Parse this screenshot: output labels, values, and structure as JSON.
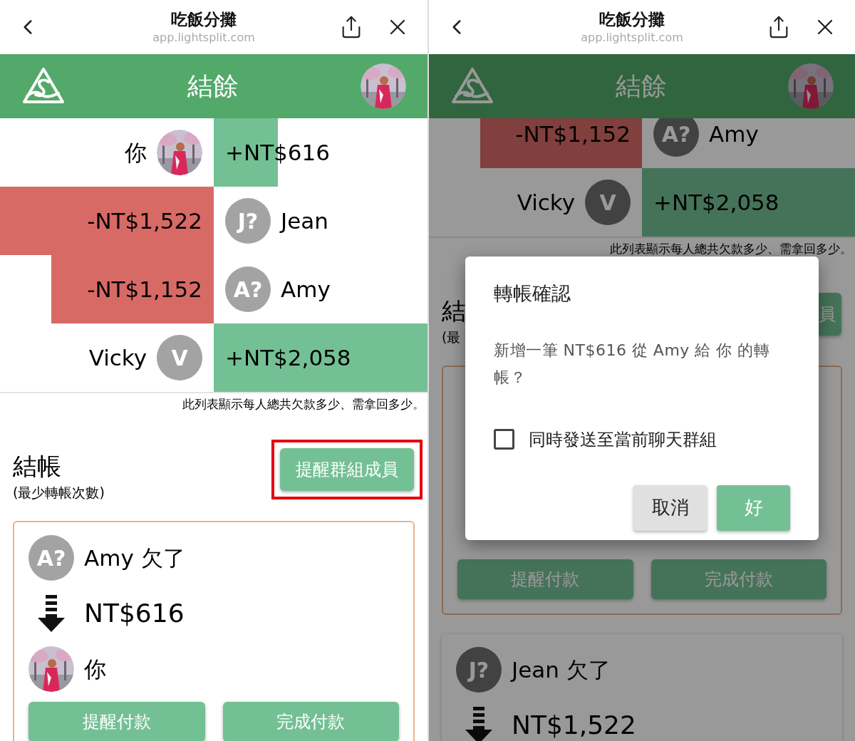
{
  "phones": [
    {
      "browser": {
        "title": "吃飯分攤",
        "url": "app.lightsplit.com"
      },
      "header": {
        "title": "結餘"
      },
      "balances": [
        {
          "kind": "credit",
          "name": "你",
          "amount": "+NT$616"
        },
        {
          "kind": "debt",
          "name": "Jean",
          "avatar": {
            "kind": "initials",
            "text": "J?"
          },
          "amount": "-NT$1,522"
        },
        {
          "kind": "debt",
          "name": "Amy",
          "avatar": {
            "kind": "initials",
            "text": "A?"
          },
          "amount": "-NT$1,152"
        },
        {
          "kind": "credit",
          "name": "Vicky",
          "avatar": {
            "kind": "initials",
            "text": "V"
          },
          "amount": "+NT$2,058"
        }
      ],
      "note": "此列表顯示每人總共欠款多少、需拿回多少。",
      "settle": {
        "title": "結帳",
        "subtitle": "(最少轉帳次數)",
        "button": "提醒群組成員",
        "highlighted": true
      },
      "debts": [
        {
          "selected": true,
          "debtor": {
            "avatar": {
              "kind": "initials",
              "text": "A?"
            },
            "text": "Amy 欠了"
          },
          "amount": "NT$616",
          "creditor": {
            "text": "你"
          },
          "buttons": [
            "提醒付款",
            "完成付款"
          ]
        }
      ]
    },
    {
      "browser": {
        "title": "吃飯分攤",
        "url": "app.lightsplit.com"
      },
      "header": {
        "title": "結餘"
      },
      "balances": [
        {
          "kind": "debt",
          "name": "Amy",
          "avatar": {
            "kind": "initials",
            "text": "A?"
          },
          "amount": "-NT$1,152"
        },
        {
          "kind": "credit",
          "name": "Vicky",
          "avatar": {
            "kind": "initials",
            "text": "V"
          },
          "amount": "+NT$2,058"
        }
      ],
      "note": "此列表顯示每人總共欠款多少、需拿回多少。",
      "settle": {
        "title": "結",
        "subtitle": "(最",
        "button": "員",
        "highlighted": false
      },
      "debts": [
        {
          "selected": true,
          "buttons": [
            "提醒付款",
            "完成付款"
          ]
        },
        {
          "selected": false,
          "debtor": {
            "avatar": {
              "kind": "initials",
              "text": "J?"
            },
            "text": "Jean 欠了"
          },
          "amount": "NT$1,522"
        }
      ],
      "dialog": {
        "title": "轉帳確認",
        "message": "新增一筆 NT$616 從 Amy 給 你 的轉帳？",
        "checkbox": {
          "label": "同時發送至當前聊天群組",
          "checked": false
        },
        "buttons": [
          {
            "label": "取消",
            "kind": "secondary"
          },
          {
            "label": "好",
            "kind": "primary"
          }
        ]
      }
    }
  ]
}
